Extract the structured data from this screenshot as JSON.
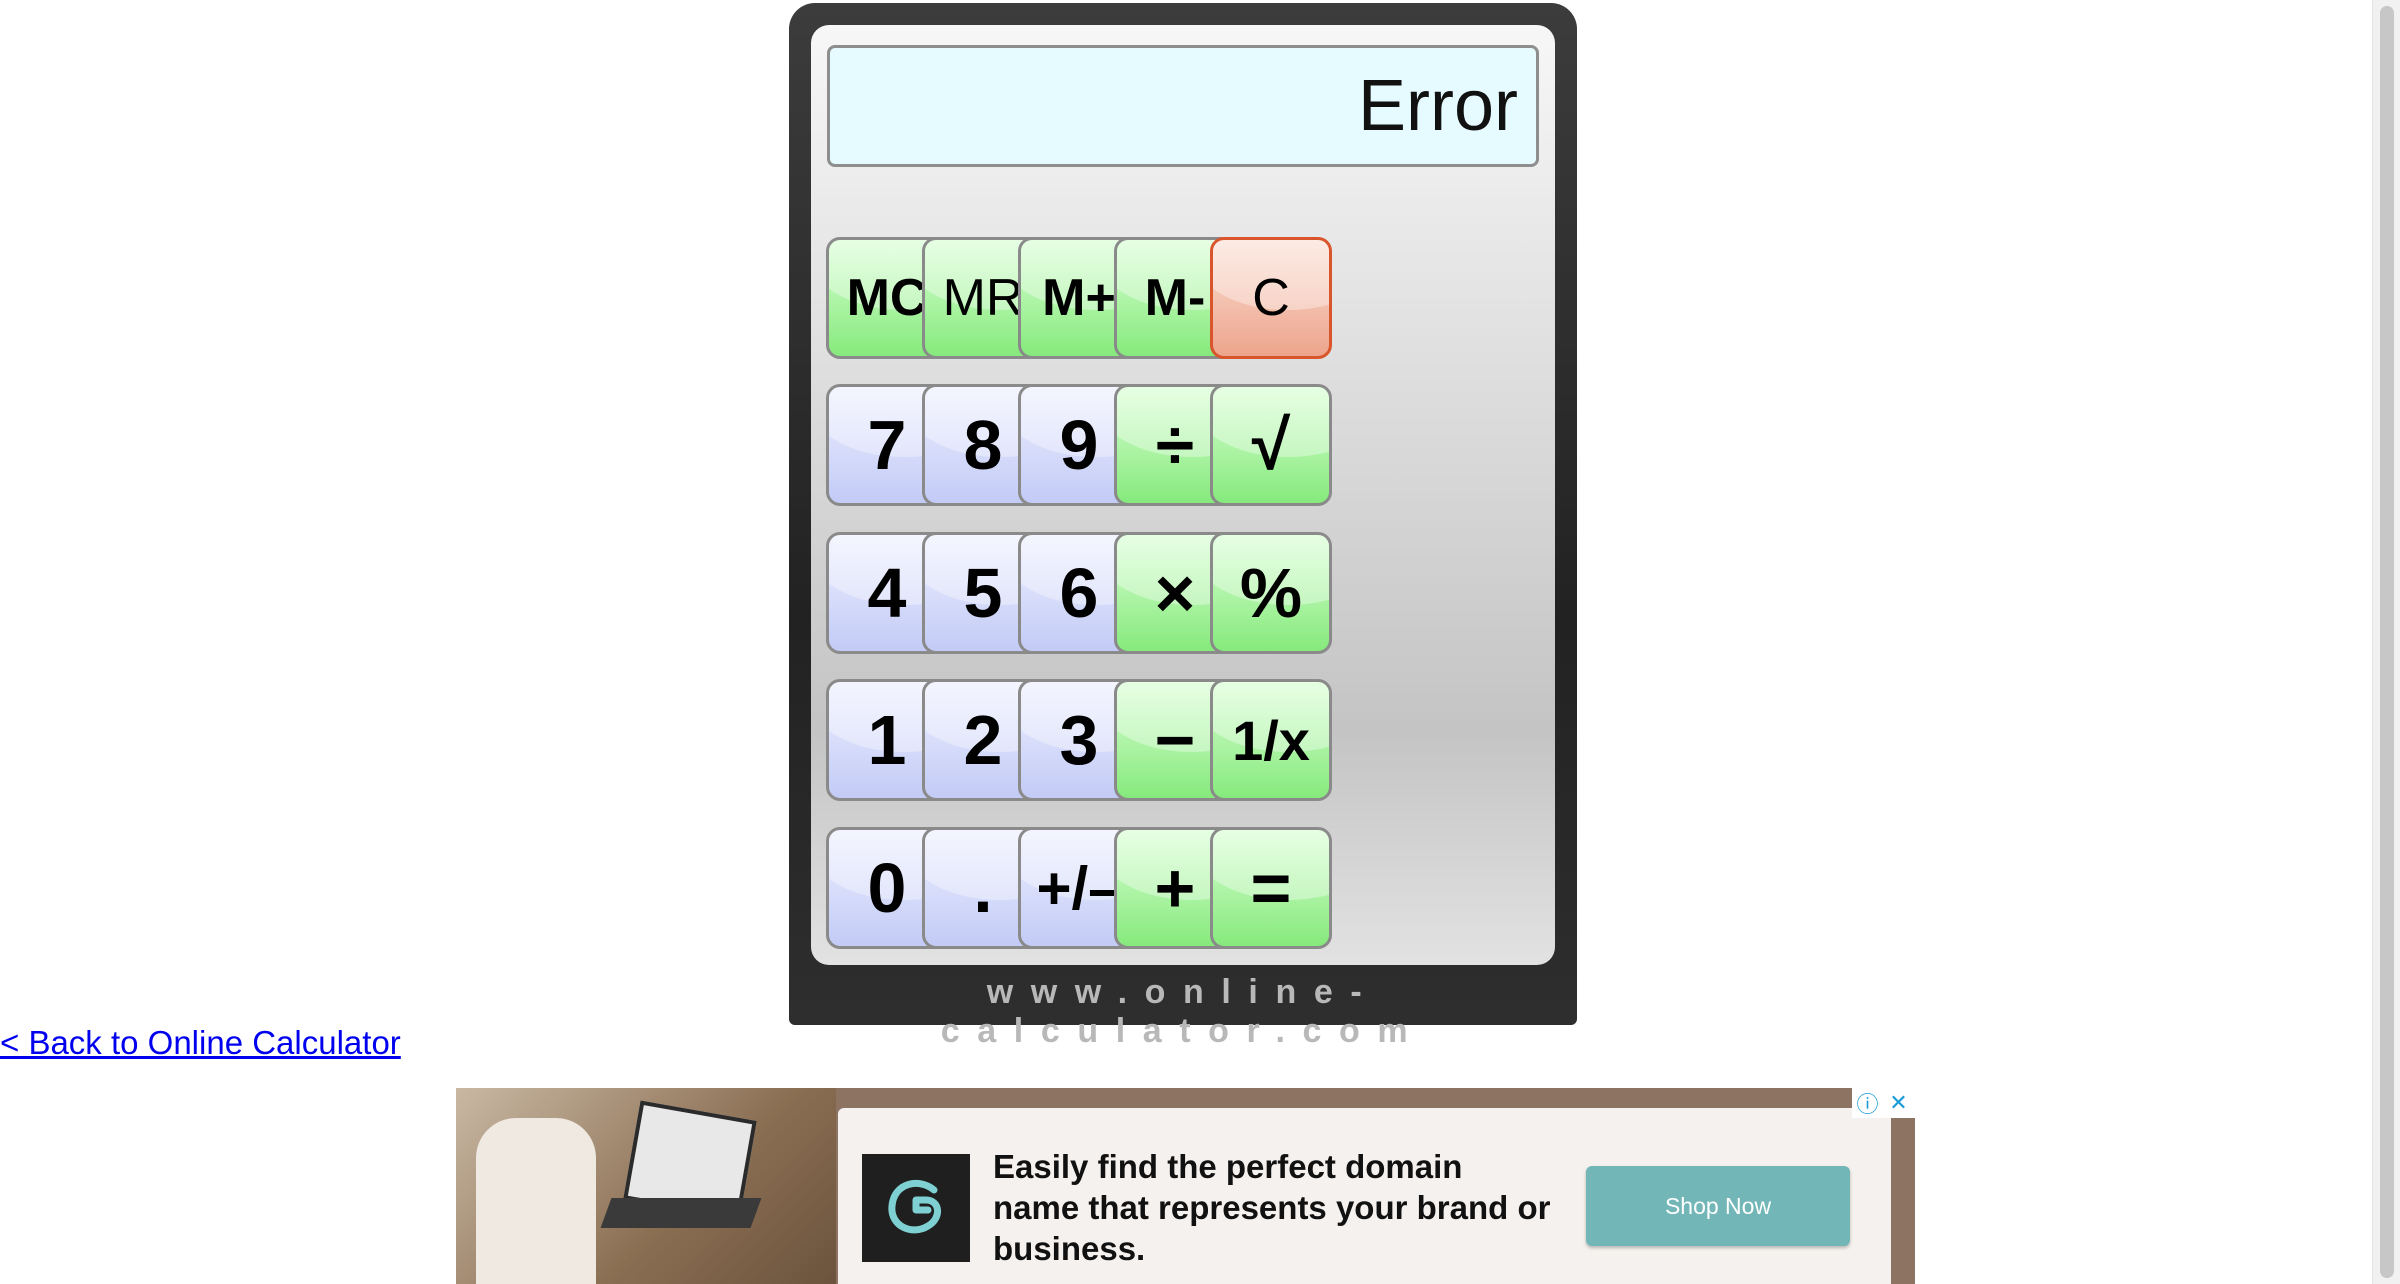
{
  "display": {
    "value": "Error"
  },
  "keys": {
    "mc": "MC",
    "mr": "MR",
    "m_plus": "M+",
    "m_minus": "M-",
    "clear": "C",
    "seven": "7",
    "eight": "8",
    "nine": "9",
    "divide": "÷",
    "sqrt": "√",
    "four": "4",
    "five": "5",
    "six": "6",
    "multiply": "×",
    "percent": "%",
    "one": "1",
    "two": "2",
    "three": "3",
    "minus": "−",
    "reciprocal": "1/x",
    "zero": "0",
    "dot": ".",
    "sign": "+/–",
    "plus": "+",
    "equals": "="
  },
  "brand": "www.online-calculator.com",
  "back_link": "< Back to Online Calculator",
  "ad": {
    "headline": "Easily find the perfect domain name that represents your brand or business.",
    "button": "Shop Now",
    "info_icon": "ⓘ",
    "close_icon": "✕"
  },
  "colors": {
    "digit_key": "#c3cbf6",
    "op_key": "#86ea7c",
    "clear_key": "#eda48c",
    "display_bg": "#e6fbff",
    "ad_button": "#72b6b8"
  }
}
